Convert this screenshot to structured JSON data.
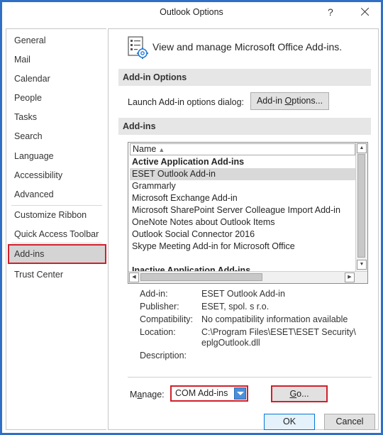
{
  "window": {
    "title": "Outlook Options",
    "help_symbol": "?"
  },
  "sidebar": {
    "items": [
      {
        "label": "General"
      },
      {
        "label": "Mail"
      },
      {
        "label": "Calendar"
      },
      {
        "label": "People"
      },
      {
        "label": "Tasks"
      },
      {
        "label": "Search"
      },
      {
        "label": "Language"
      },
      {
        "label": "Accessibility"
      },
      {
        "label": "Advanced"
      },
      {
        "label": "Customize Ribbon"
      },
      {
        "label": "Quick Access Toolbar"
      },
      {
        "label": "Add-ins",
        "selected": true
      },
      {
        "label": "Trust Center"
      }
    ]
  },
  "header": {
    "title": "View and manage Microsoft Office Add-ins."
  },
  "addin_options": {
    "section_title": "Add-in Options",
    "launch_label": "Launch Add-in options dialog:",
    "button_label_pre": "Add-in ",
    "button_label_key": "O",
    "button_label_post": "ptions..."
  },
  "addins": {
    "section_title": "Add-ins",
    "column_header": "Name",
    "sort_indicator": "▲",
    "rows": [
      {
        "label": "Active Application Add-ins",
        "group": true
      },
      {
        "label": "ESET Outlook Add-in",
        "selected": true
      },
      {
        "label": "Grammarly"
      },
      {
        "label": "Microsoft Exchange Add-in"
      },
      {
        "label": "Microsoft SharePoint Server Colleague Import Add-in"
      },
      {
        "label": "OneNote Notes about Outlook Items"
      },
      {
        "label": "Outlook Social Connector 2016"
      },
      {
        "label": "Skype Meeting Add-in for Microsoft Office"
      },
      {
        "label": "Inactive Application Add-ins",
        "group": true
      }
    ]
  },
  "details": {
    "addin_label": "Add-in:",
    "addin_value": "ESET Outlook Add-in",
    "publisher_label": "Publisher:",
    "publisher_value": "ESET, spol. s r.o.",
    "compat_label": "Compatibility:",
    "compat_value": "No compatibility information available",
    "location_label": "Location:",
    "location_value_line1": "C:\\Program Files\\ESET\\ESET Security\\",
    "location_value_line2": "eplgOutlook.dll",
    "description_label": "Description:"
  },
  "manage": {
    "label_pre": "M",
    "label_key": "a",
    "label_post": "nage:",
    "selected_value": "COM Add-ins",
    "go_key": "G",
    "go_post": "o..."
  },
  "footer": {
    "ok_label": "OK",
    "cancel_label": "Cancel"
  },
  "colors": {
    "highlight_border": "#d0202c",
    "accent": "#0078d7"
  }
}
